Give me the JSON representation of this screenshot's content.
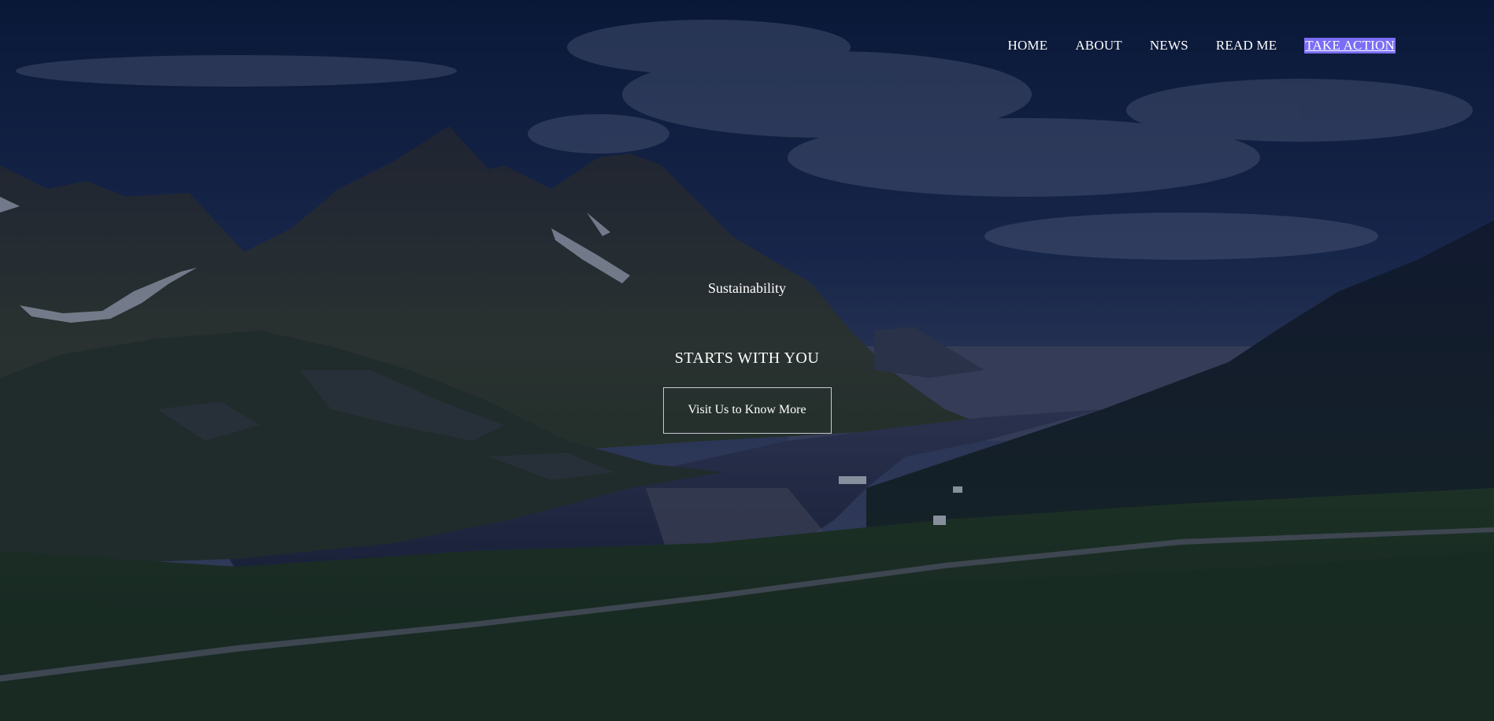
{
  "nav": {
    "items": [
      {
        "label": "HOME",
        "active": false
      },
      {
        "label": "ABOUT",
        "active": false
      },
      {
        "label": "NEWS",
        "active": false
      },
      {
        "label": "READ ME",
        "active": false
      },
      {
        "label": "TAKE ACTION",
        "active": true
      }
    ]
  },
  "hero": {
    "subtitle": "Sustainability",
    "headline": "STARTS WITH YOU",
    "cta_label": "Visit Us to Know More"
  },
  "colors": {
    "overlay": "#0b1a3a",
    "active_highlight": "#7b6ef6",
    "text": "#ffffff",
    "button_border": "#c9c9d4"
  }
}
